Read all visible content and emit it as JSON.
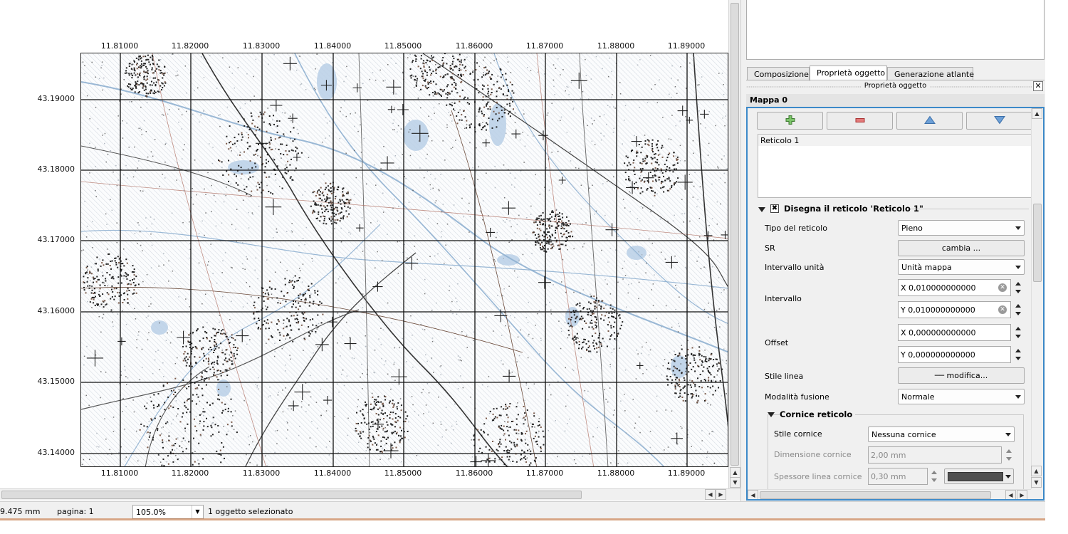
{
  "map": {
    "x_labels": [
      "11.81000",
      "11.82000",
      "11.83000",
      "11.84000",
      "11.85000",
      "11.86000",
      "11.87000",
      "11.88000",
      "11.89000"
    ],
    "y_labels": [
      "43.19000",
      "43.18000",
      "43.17000",
      "43.16000",
      "43.15000",
      "43.14000"
    ]
  },
  "statusbar": {
    "position": "9.475 mm",
    "page": "pagina: 1",
    "zoom": "105.0%",
    "selection": "1 oggetto selezionato"
  },
  "dock": {
    "tabs": [
      "Composizione",
      "Proprietà oggetto",
      "Generazione atlante"
    ],
    "active_tab": 1,
    "panel_title": "Proprietà oggetto",
    "section_title": "Mappa 0",
    "toolbar_icons": [
      "add-icon",
      "remove-icon",
      "move-up-icon",
      "move-down-icon"
    ],
    "grid_list": [
      "Reticolo 1"
    ],
    "group_title": "Disegna il reticolo 'Reticolo 1\"",
    "group_checked": "✖",
    "fields": {
      "grid_type_label": "Tipo del reticolo",
      "grid_type_value": "Pieno",
      "crs_label": "SR",
      "crs_button": "cambia ...",
      "interval_units_label": "Intervallo unità",
      "interval_units_value": "Unità mappa",
      "interval_label": "Intervallo",
      "interval_x": "X 0,010000000000",
      "interval_y": "Y 0,010000000000",
      "offset_label": "Offset",
      "offset_x": "X 0,000000000000",
      "offset_y": "Y 0,000000000000",
      "line_style_label": "Stile linea",
      "line_style_button": "── modifica...",
      "blend_label": "Modalità fusione",
      "blend_value": "Normale"
    },
    "frame_group": {
      "title": "Cornice reticolo",
      "frame_style_label": "Stile cornice",
      "frame_style_value": "Nessuna cornice",
      "frame_size_label": "Dimensione cornice",
      "frame_size_value": "2,00 mm",
      "frame_line_label": "Spessore linea cornice",
      "frame_line_value": "0,30 mm",
      "frame_color": "#505050"
    }
  }
}
